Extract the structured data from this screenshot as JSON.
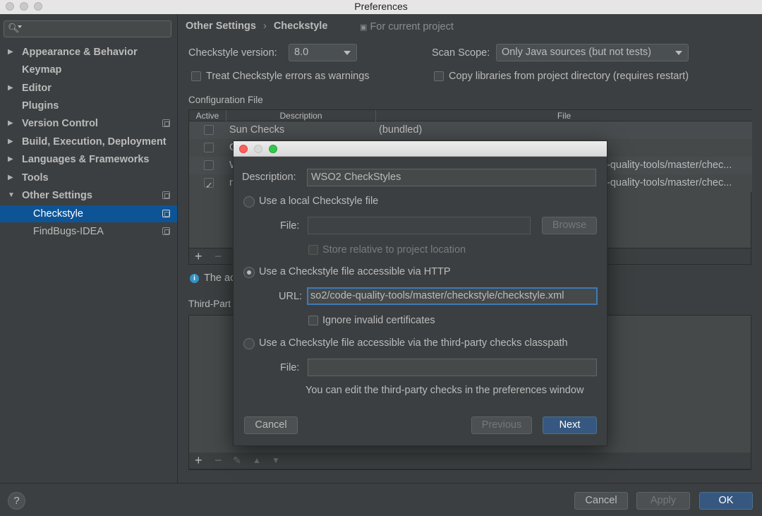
{
  "window": {
    "title": "Preferences"
  },
  "sidebar": {
    "search_placeholder": "",
    "items": [
      {
        "label": "Appearance & Behavior",
        "arrow": "▶"
      },
      {
        "label": "Keymap",
        "arrow": ""
      },
      {
        "label": "Editor",
        "arrow": "▶"
      },
      {
        "label": "Plugins",
        "arrow": ""
      },
      {
        "label": "Version Control",
        "arrow": "▶"
      },
      {
        "label": "Build, Execution, Deployment",
        "arrow": "▶"
      },
      {
        "label": "Languages & Frameworks",
        "arrow": "▶"
      },
      {
        "label": "Tools",
        "arrow": "▶"
      },
      {
        "label": "Other Settings",
        "arrow": "▼"
      },
      {
        "label": "Checkstyle"
      },
      {
        "label": "FindBugs-IDEA"
      }
    ]
  },
  "header": {
    "crumb_parent": "Other Settings",
    "separator": "›",
    "crumb_current": "Checkstyle",
    "scope_note": "For current project"
  },
  "settings": {
    "version_label": "Checkstyle version:",
    "version_value": "8.0",
    "scope_label": "Scan Scope:",
    "scope_value": "Only Java sources (but not tests)",
    "treat_warnings_label": "Treat Checkstyle errors as warnings",
    "copy_libs_label": "Copy libraries from project directory (requires restart)"
  },
  "config": {
    "section_label": "Configuration File",
    "columns": [
      "Active",
      "Description",
      "File"
    ],
    "rows": [
      {
        "description": "Sun Checks",
        "file": "(bundled)",
        "active": false
      },
      {
        "description": "G",
        "file": "",
        "active": false
      },
      {
        "description": "W",
        "file": "-quality-tools/master/chec...",
        "active": false
      },
      {
        "description": "m",
        "file": "-quality-tools/master/chec...",
        "active": true
      }
    ],
    "info_text": "The ac",
    "thirdparty_label": "Third-Part"
  },
  "dialog": {
    "description_label": "Description:",
    "description_value": "WSO2 CheckStyles",
    "local_option": "Use a local Checkstyle file",
    "file_label": "File:",
    "browse_label": "Browse",
    "store_relative_label": "Store relative to project location",
    "http_option": "Use a Checkstyle file accessible via HTTP",
    "url_label": "URL:",
    "url_value": "so2/code-quality-tools/master/checkstyle/checkstyle.xml",
    "ignore_certs_label": "Ignore invalid certificates",
    "classpath_option": "Use a Checkstyle file accessible via the third-party checks classpath",
    "file2_label": "File:",
    "hint": "You can edit the third-party checks in the preferences window",
    "cancel": "Cancel",
    "previous": "Previous",
    "next": "Next"
  },
  "footer": {
    "help": "?",
    "cancel": "Cancel",
    "apply": "Apply",
    "ok": "OK"
  },
  "colors": {
    "selection": "#0d5497",
    "default_button": "#365880",
    "focus_border": "#3d7ab8",
    "traffic_red": "#fc605c",
    "traffic_yellow": "#d8d8d8",
    "traffic_green": "#34c84a"
  },
  "icons": [
    "search-icon",
    "project-scope-icon",
    "info-icon",
    "add-icon",
    "remove-icon",
    "edit-icon",
    "move-up-icon",
    "move-down-icon",
    "help-icon"
  ]
}
